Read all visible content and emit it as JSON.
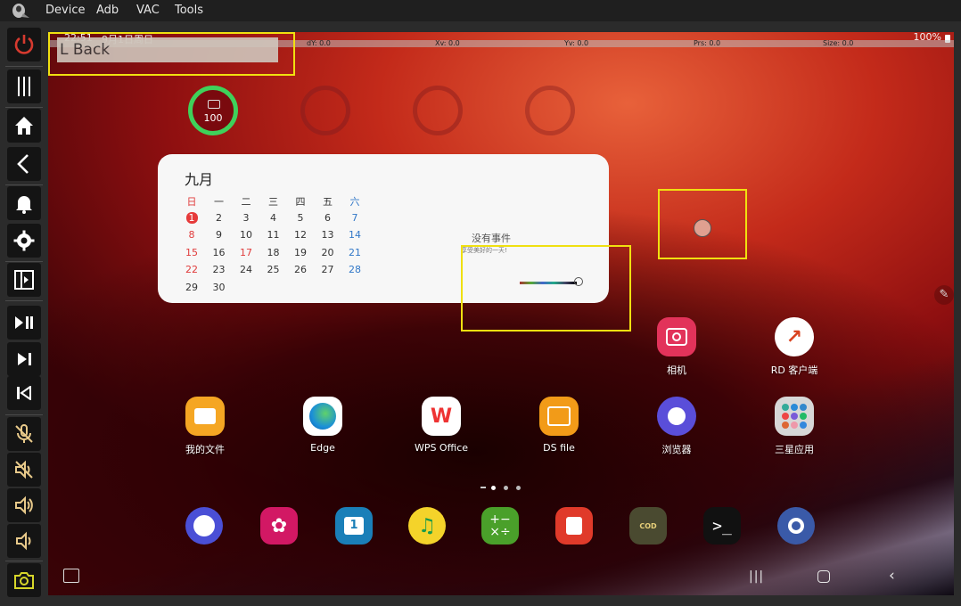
{
  "menubar": {
    "items": [
      "Device",
      "Adb",
      "VAC",
      "Tools"
    ]
  },
  "toolbar": {
    "buttons": [
      "power-icon",
      "menu-icon",
      "home-icon",
      "back-icon",
      "notification-icon",
      "settings-icon",
      "panel-icon",
      "play-pause-icon",
      "next-icon",
      "previous-icon",
      "mic-off-icon",
      "volume-mute-icon",
      "volume-up-icon",
      "volume-down-icon",
      "camera-icon"
    ],
    "accent_power": "#d63a2f",
    "accent_camera": "#d7d62a"
  },
  "status": {
    "time": "22:51",
    "date": "9月1日周日",
    "battery": "100%"
  },
  "debug": {
    "dy": "dY: 0.0",
    "xv": "Xv: 0.0",
    "yv": "Yv: 0.0",
    "prs": "Prs: 0.0",
    "size": "Size: 0.0"
  },
  "overlay": {
    "back_label": "L Back"
  },
  "battery_widget": {
    "value": "100"
  },
  "calendar": {
    "month": "九月",
    "weekdays": [
      "日",
      "一",
      "二",
      "三",
      "四",
      "五",
      "六"
    ],
    "weeks": [
      [
        "1",
        "2",
        "3",
        "4",
        "5",
        "6",
        "7"
      ],
      [
        "8",
        "9",
        "10",
        "11",
        "12",
        "13",
        "14"
      ],
      [
        "15",
        "16",
        "17",
        "18",
        "19",
        "20",
        "21"
      ],
      [
        "22",
        "23",
        "24",
        "25",
        "26",
        "27",
        "28"
      ],
      [
        "29",
        "30",
        "",
        "",
        "",
        "",
        ""
      ]
    ],
    "no_events": "没有事件",
    "subtitle": "享受美好的一天!"
  },
  "apps_row1": [
    {
      "name": "camera-app",
      "label": "相机",
      "color": "#e2335a"
    },
    {
      "name": "rd-client-app",
      "label": "RD 客户端",
      "color": "#d9421f"
    }
  ],
  "apps_row2": [
    {
      "name": "my-files-app",
      "label": "我的文件",
      "color": "#f5a623"
    },
    {
      "name": "edge-app",
      "label": "Edge",
      "color": "#1a8fd8"
    },
    {
      "name": "wps-office-app",
      "label": "WPS Office",
      "color": "#e33"
    },
    {
      "name": "ds-file-app",
      "label": "DS file",
      "color": "#f29b18"
    },
    {
      "name": "browser-app",
      "label": "浏览器",
      "color": "#5a4ed9"
    },
    {
      "name": "samsung-apps-folder",
      "label": "三星应用",
      "color": "#c9c9c9"
    }
  ],
  "dock": [
    {
      "name": "clock-app",
      "color": "#4a4fd6"
    },
    {
      "name": "gallery-app",
      "color": "#d21864"
    },
    {
      "name": "calendar-app",
      "color": "#1a7fb8"
    },
    {
      "name": "qq-music-app",
      "color": "#f4d32a"
    },
    {
      "name": "calculator-app",
      "color": "#4aa02a"
    },
    {
      "name": "notes-app",
      "color": "#e03a2a"
    },
    {
      "name": "call-of-duty-app",
      "color": "#3a3a2a"
    },
    {
      "name": "terminal-app",
      "color": "#111111"
    },
    {
      "name": "settings-app",
      "color": "#3a5aa8"
    }
  ]
}
